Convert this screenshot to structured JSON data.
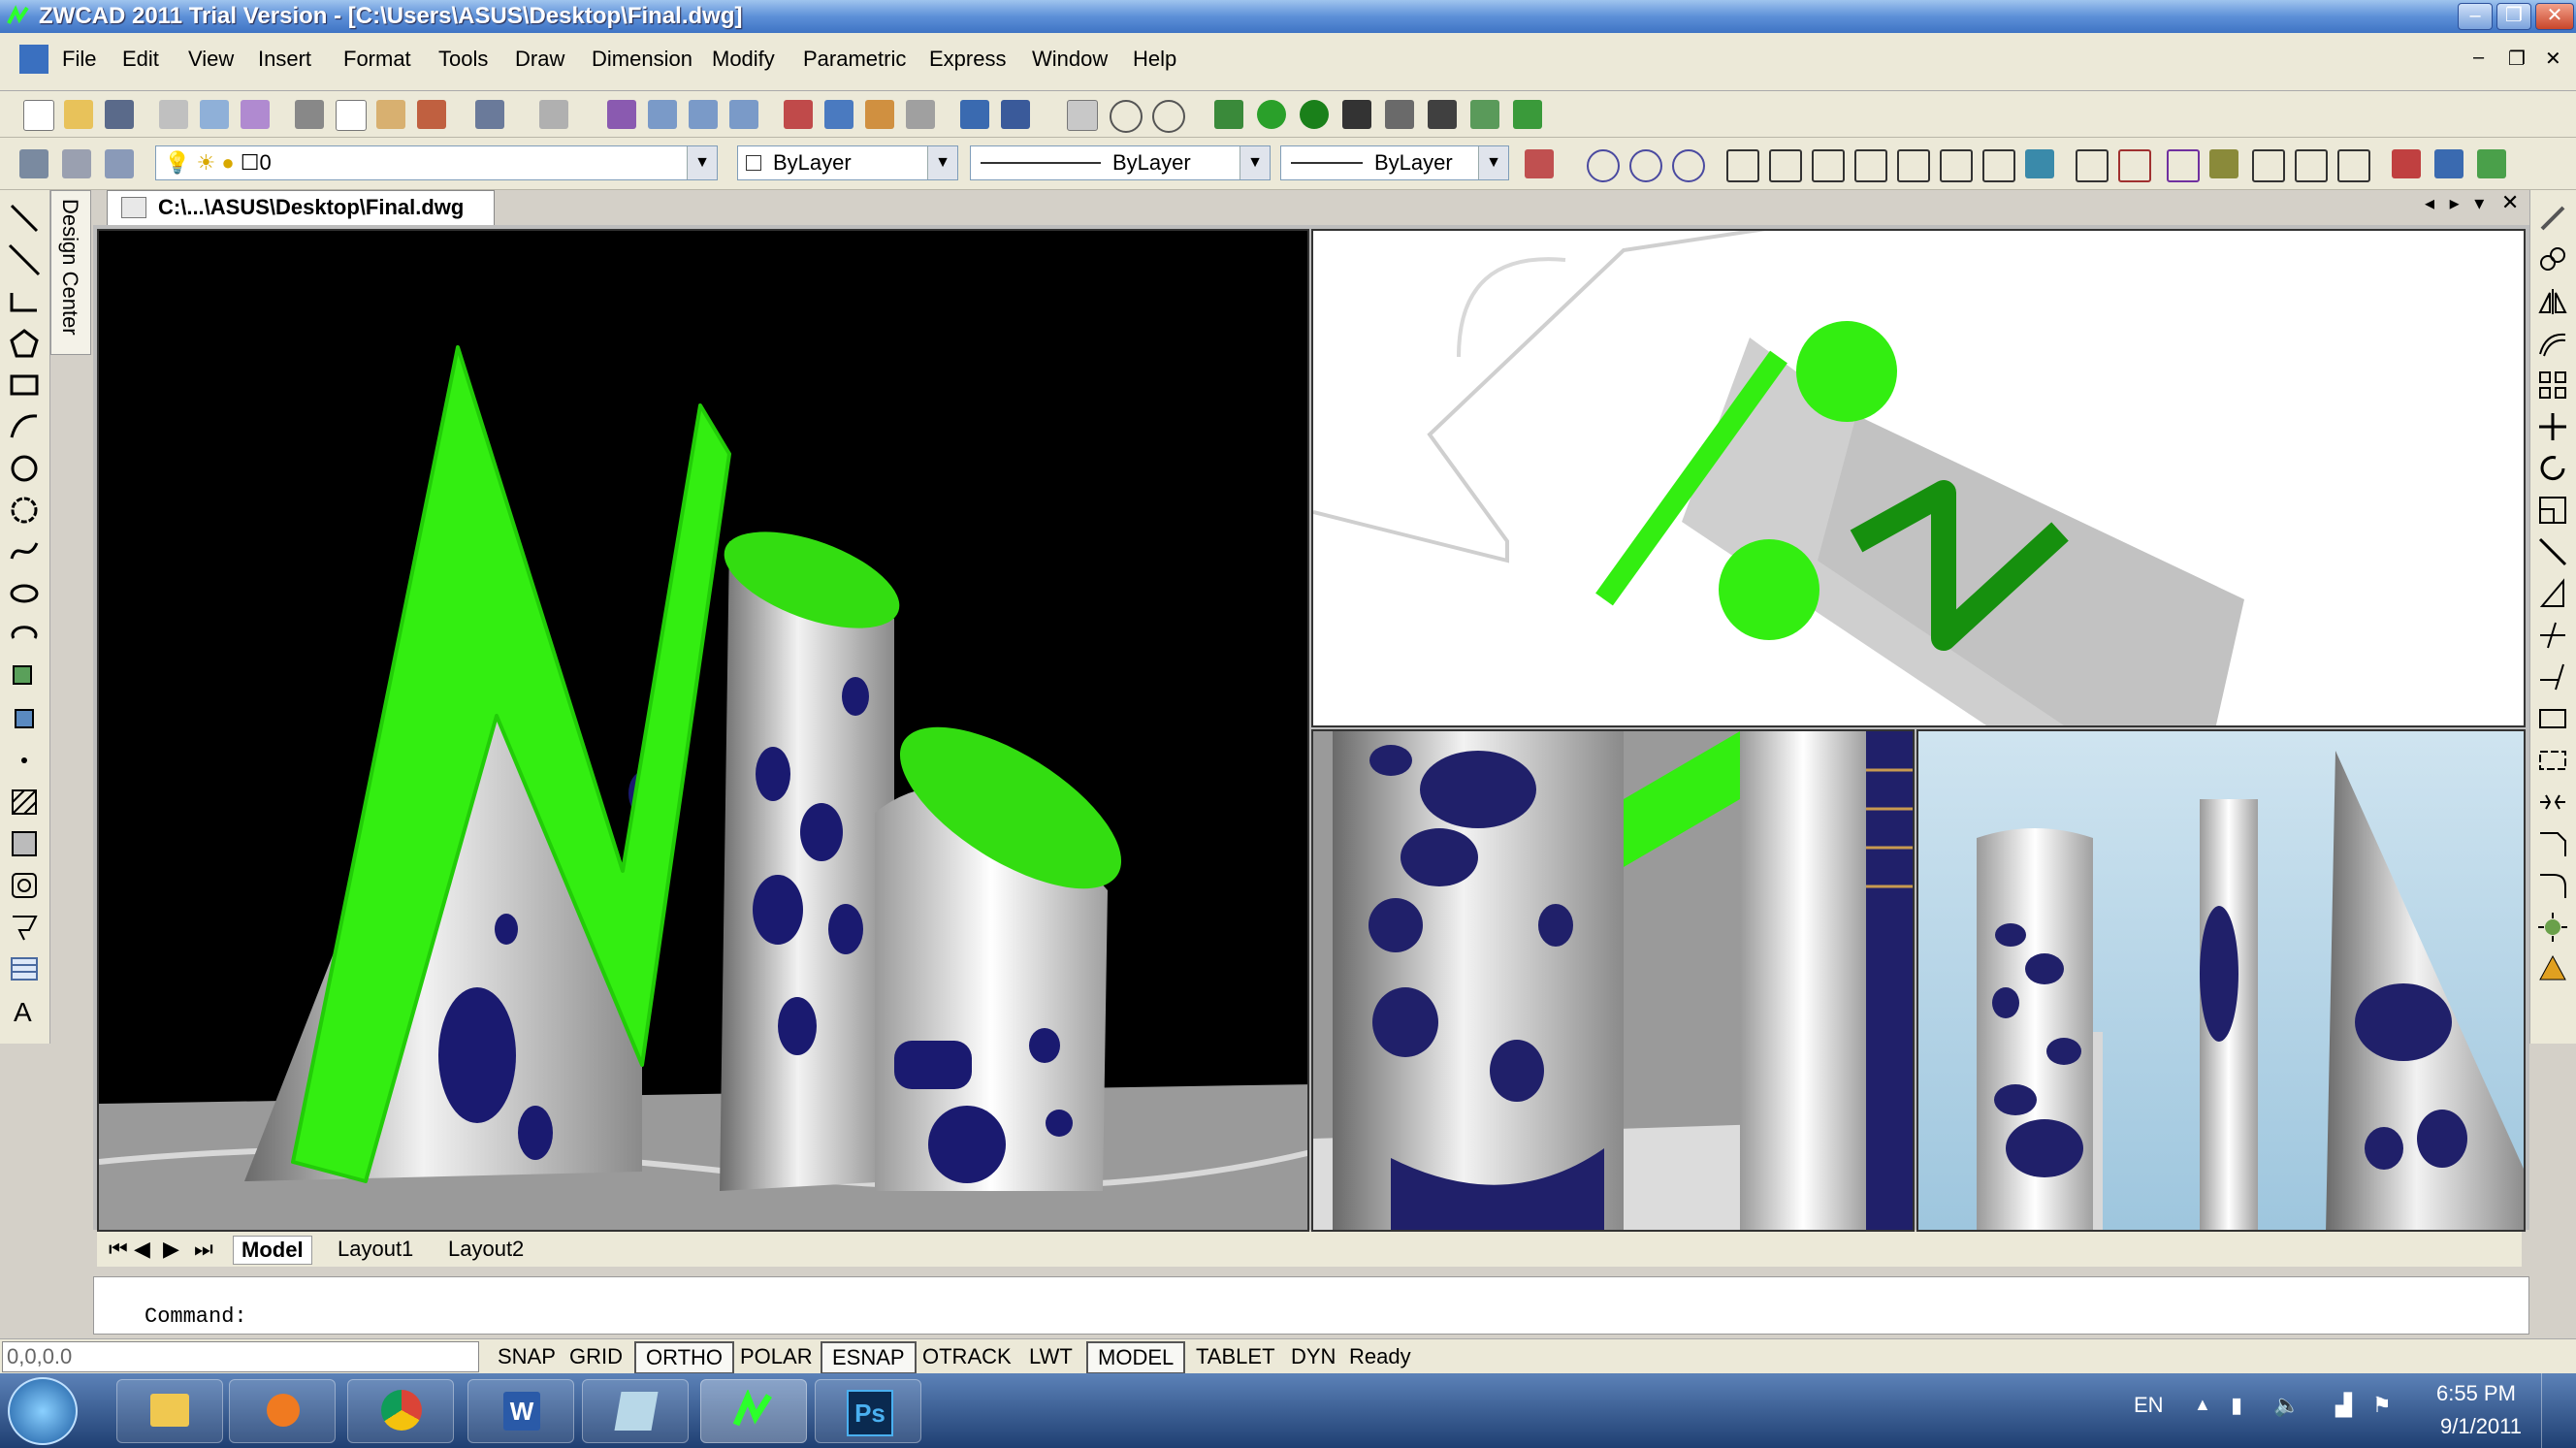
{
  "window": {
    "title": "ZWCAD 2011 Trial Version - [C:\\Users\\ASUS\\Desktop\\Final.dwg]"
  },
  "menu": [
    "File",
    "Edit",
    "View",
    "Insert",
    "Format",
    "Tools",
    "Draw",
    "Dimension",
    "Modify",
    "Parametric",
    "Express",
    "Window",
    "Help"
  ],
  "layer_toolbar": {
    "layer_value": "0",
    "color_value": "ByLayer",
    "linetype_value": "ByLayer",
    "lineweight_value": "ByLayer"
  },
  "design_center_label": "Design Center",
  "document_tab": "C:\\...\\ASUS\\Desktop\\Final.dwg",
  "layout_tabs": [
    "Model",
    "Layout1",
    "Layout2"
  ],
  "command": {
    "prompt": "Command:"
  },
  "status": {
    "coordinates": "0,0,0.0",
    "toggles": [
      {
        "label": "SNAP",
        "on": false
      },
      {
        "label": "GRID",
        "on": false
      },
      {
        "label": "ORTHO",
        "on": true
      },
      {
        "label": "POLAR",
        "on": false
      },
      {
        "label": "ESNAP",
        "on": true
      },
      {
        "label": "OTRACK",
        "on": false
      },
      {
        "label": "LWT",
        "on": false
      },
      {
        "label": "MODEL",
        "on": true
      },
      {
        "label": "TABLET",
        "on": false
      },
      {
        "label": "DYN",
        "on": false
      }
    ],
    "ready": "Ready"
  },
  "taskbar": {
    "lang": "EN",
    "time": "6:55 PM",
    "date": "9/1/2011",
    "ps_label": "Ps"
  },
  "colors": {
    "accent_green": "#22e010",
    "title_blue": "#3f74c4"
  }
}
